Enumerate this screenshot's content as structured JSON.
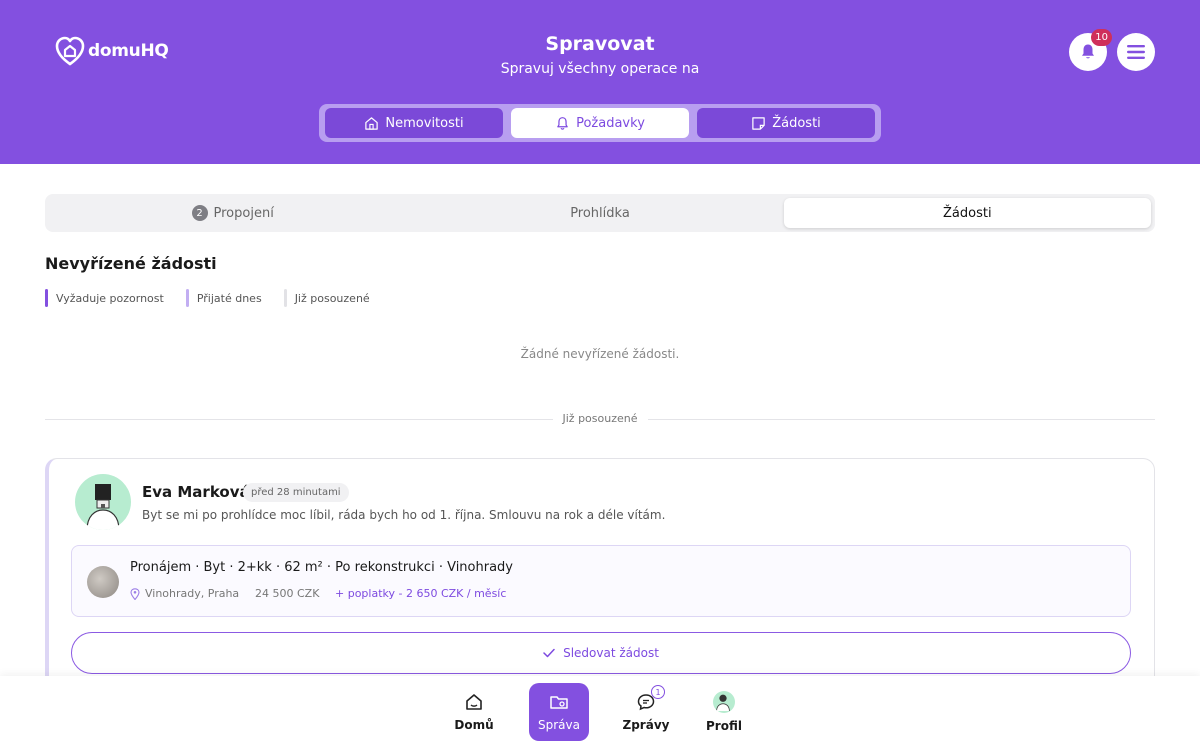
{
  "brand": {
    "logo_text": "domuHQ"
  },
  "header": {
    "title": "Spravovat",
    "subtitle": "Spravuj všechny operace na",
    "notifications_count": "10"
  },
  "main_tabs": [
    {
      "label": "Nemovitosti",
      "icon": "home-icon",
      "active": false
    },
    {
      "label": "Požadavky",
      "icon": "bell-icon",
      "active": true
    },
    {
      "label": "Žádosti",
      "icon": "note-icon",
      "active": false
    }
  ],
  "sub_tabs": [
    {
      "label": "Propojení",
      "count": "2",
      "active": false
    },
    {
      "label": "Prohlídka",
      "active": false
    },
    {
      "label": "Žádosti",
      "active": true
    }
  ],
  "pending": {
    "title": "Nevyřízené žádosti",
    "legend": [
      {
        "label": "Vyžaduje pozornost",
        "color": "#8350e0"
      },
      {
        "label": "Přijaté dnes",
        "color": "#c2aef2"
      },
      {
        "label": "Již posouzené",
        "color": "#e2e2e6"
      }
    ],
    "empty_message": "Žádné nevyřízené žádosti."
  },
  "reviewed": {
    "divider_label": "Již posouzené",
    "request": {
      "name": "Eva Marková",
      "time": "před 28 minutami",
      "message": "Byt se mi po prohlídce moc líbil, ráda bych ho od 1. října. Smlouvu na rok a déle vítám.",
      "property": {
        "title": "Pronájem · Byt · 2+kk · 62 m² · Po rekonstrukci · Vinohrady",
        "location": "Vinohrady, Praha",
        "price": "24 500 CZK",
        "fees": "+ poplatky - 2 650 CZK / měsíc"
      },
      "action_label": "Sledovat žádost"
    }
  },
  "bottom_nav": [
    {
      "label": "Domů",
      "icon": "home-icon",
      "active": false
    },
    {
      "label": "Správa",
      "icon": "folder-gear-icon",
      "active": true
    },
    {
      "label": "Zprávy",
      "icon": "chat-icon",
      "badge": "1",
      "active": false
    },
    {
      "label": "Profil",
      "icon": "avatar",
      "active": false
    }
  ],
  "colors": {
    "brand": "#8350e0",
    "accent_text": "#7d4ae0",
    "badge": "#cf2f5b"
  }
}
